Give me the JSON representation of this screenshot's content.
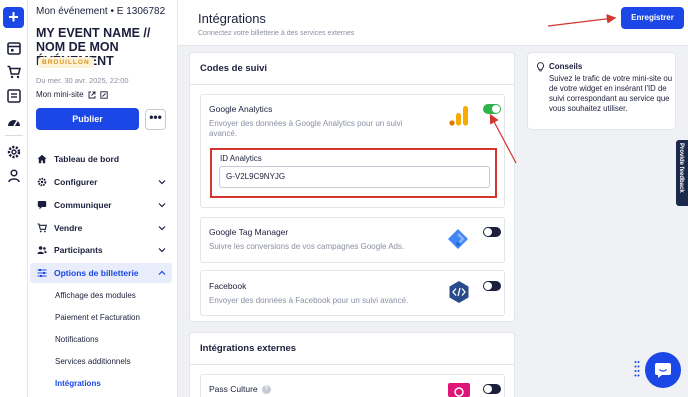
{
  "rail": {
    "plus_label": "+"
  },
  "event": {
    "header": "Mon événement • E 1306782",
    "title": "MY EVENT NAME // NOM DE MON ÉVÉNEMENT",
    "status": "BROUILLON",
    "date": "Du mer. 30 avr. 2025, 22:00",
    "minisite_label": "Mon mini-site",
    "publish_label": "Publier",
    "more_label": "•••"
  },
  "nav": {
    "items": [
      {
        "label": "Tableau de bord"
      },
      {
        "label": "Configurer"
      },
      {
        "label": "Communiquer"
      },
      {
        "label": "Vendre"
      },
      {
        "label": "Participants"
      },
      {
        "label": "Options de billetterie"
      }
    ],
    "subitems": [
      {
        "label": "Affichage des modules"
      },
      {
        "label": "Paiement et Facturation"
      },
      {
        "label": "Notifications"
      },
      {
        "label": "Services additionnels"
      },
      {
        "label": "Intégrations"
      }
    ]
  },
  "page": {
    "title": "Intégrations",
    "subtitle": "Connectez votre billetterie à des services externes",
    "save_label": "Enregistrer"
  },
  "tracking": {
    "title": "Codes de suivi",
    "google_analytics": {
      "name": "Google Analytics",
      "description": "Envoyer des données à Google Analytics pour un suivi avancé.",
      "enabled": true,
      "id_label": "ID Analytics",
      "id_value": "G-V2L9C9NYJG"
    },
    "google_tag_manager": {
      "name": "Google Tag Manager",
      "description": "Suivre les conversions de vos campagnes Google Ads.",
      "enabled": false
    },
    "facebook": {
      "name": "Facebook",
      "description": "Envoyer des données à Facebook pour un suivi avancé.",
      "enabled": false
    }
  },
  "external": {
    "title": "Intégrations externes",
    "pass_culture": {
      "name": "Pass Culture",
      "help": "?",
      "enabled": false
    }
  },
  "tips": {
    "title": "Conseils",
    "text": "Suivez le trafic de votre mini-site ou de votre widget en insérant l'ID de suivi correspondant au service que vous souhaitez utiliser."
  },
  "feedback_label": "Provide feedback",
  "colors": {
    "primary": "#1a47e6",
    "toggle_on": "#2fb34a",
    "highlight": "#d3352f",
    "draft_bg": "#fdf2d8",
    "draft_text": "#d9941a"
  }
}
